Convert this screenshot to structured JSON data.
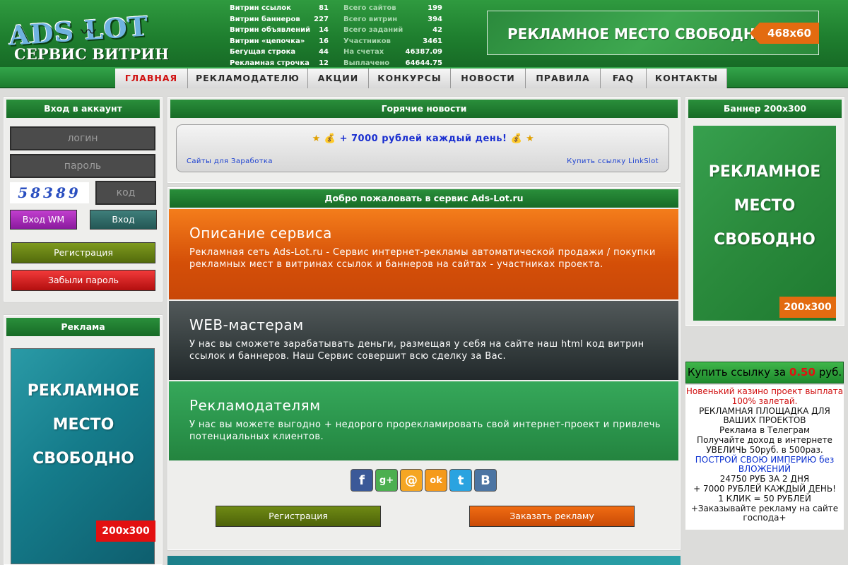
{
  "header": {
    "logo_word": "ADS  LOT",
    "logo_subtitle": "СЕРВИС ВИТРИН",
    "stats_left": [
      {
        "label": "Витрин ссылок",
        "value": "81"
      },
      {
        "label": "Витрин баннеров",
        "value": "227"
      },
      {
        "label": "Витрин объявлений",
        "value": "14"
      },
      {
        "label": "Витрин «цепочка»",
        "value": "16"
      },
      {
        "label": "Бегущая строка",
        "value": "44"
      },
      {
        "label": "Рекламная строчка",
        "value": "12"
      }
    ],
    "stats_right": [
      {
        "label": "Всего сайтов",
        "value": "199"
      },
      {
        "label": "Всего витрин",
        "value": "394"
      },
      {
        "label": "Всего заданий",
        "value": "42"
      },
      {
        "label": "Участников",
        "value": "3461"
      },
      {
        "label": "На счетах",
        "value": "46387.09"
      },
      {
        "label": "Выплачено",
        "value": "64644.75"
      }
    ],
    "banner_text": "РЕКЛАМНОЕ МЕСТО СВОБОДНО",
    "banner_size": "468x60"
  },
  "nav": [
    {
      "label": "ГЛАВНАЯ"
    },
    {
      "label": "РЕКЛАМОДАТЕЛЮ"
    },
    {
      "label": "АКЦИИ"
    },
    {
      "label": "КОНКУРСЫ"
    },
    {
      "label": "НОВОСТИ"
    },
    {
      "label": "ПРАВИЛА"
    },
    {
      "label": "FAQ"
    },
    {
      "label": "КОНТАКТЫ"
    }
  ],
  "login": {
    "title": "Вход в аккаунт",
    "login_placeholder": "логин",
    "password_placeholder": "пароль",
    "captcha_text": "58389",
    "code_placeholder": "код",
    "wm_button": "Вход WM",
    "login_button": "Вход",
    "register_button": "Регистрация",
    "forgot_button": "Забыли пароль"
  },
  "ads_left": {
    "title": "Реклама",
    "text_lines": [
      "РЕКЛАМНОЕ",
      "МЕСТО",
      "СВОБОДНО"
    ],
    "size": "200x300"
  },
  "hot_news": {
    "title": "Горячие новости",
    "headline": "+ 7000 рублей каждый день!",
    "link_left": "Сайты для Заработка",
    "link_right": "Купить ссылку LinkSlot"
  },
  "welcome": {
    "title": "Добро пожаловать в сервис Ads-Lot.ru",
    "sections": [
      {
        "heading": "Описание сервиса",
        "text": "Рекламная сеть Ads-Lot.ru - Сервис интернет-рекламы автоматической продажи / покупки рекламных мест в витринах ссылок и баннеров на сайтах - участниках проекта."
      },
      {
        "heading": "WEB-мастерам",
        "text": "У нас вы сможете зарабатывать деньги, размещая у себя на сайте наш html код витрин ссылок и баннеров. Наш Сервис совершит всю сделку за Вас."
      },
      {
        "heading": "Рекламодателям",
        "text": "У нас вы можете выгодно + недорого прорекламировать свой интернет-проект и привлечь потенциальных клиентов."
      }
    ],
    "register_button": "Регистрация",
    "order_button": "Заказать рекламу"
  },
  "social": [
    {
      "icon": "facebook-icon",
      "glyph": "f",
      "color": "#3b5998"
    },
    {
      "icon": "google-icon",
      "glyph": "g+",
      "color": "#4caf50"
    },
    {
      "icon": "mail-icon",
      "glyph": "@",
      "color": "#f5a623"
    },
    {
      "icon": "odnoklassniki-icon",
      "glyph": "ok",
      "color": "#f59a1b"
    },
    {
      "icon": "twitter-icon",
      "glyph": "t",
      "color": "#2aa3e0"
    },
    {
      "icon": "vk-icon",
      "glyph": "B",
      "color": "#4c75a3"
    }
  ],
  "banner_right": {
    "title": "Баннер 200x300",
    "text_lines": [
      "РЕКЛАМНОЕ",
      "МЕСТО",
      "СВОБОДНО"
    ],
    "size": "200x300"
  },
  "buy_link": {
    "prefix": "Купить ссылку за",
    "price": "0.50",
    "suffix": "руб."
  },
  "info_lines": [
    {
      "text": "Новенький казино проект выплата",
      "color": "red"
    },
    {
      "text": "100% залетай.",
      "color": "red"
    },
    {
      "text": "РЕКЛАМНАЯ ПЛОЩАДКА ДЛЯ",
      "color": "black"
    },
    {
      "text": "ВАШИХ ПРОЕКТОВ",
      "color": "black"
    },
    {
      "text": "Реклама в Телеграм",
      "color": "black"
    },
    {
      "text": "Получайте доход в интернете",
      "color": "black"
    },
    {
      "text": "УВЕЛИЧЬ 50руб. в 500раз.",
      "color": "black"
    },
    {
      "text": "ПОСТРОЙ СВОЮ ИМПЕРИЮ без",
      "color": "blue"
    },
    {
      "text": "ВЛОЖЕНИЙ",
      "color": "blue"
    },
    {
      "text": "24750 РУБ ЗА 2 ДНЯ",
      "color": "black"
    },
    {
      "text": "+ 7000 РУБЛЕЙ КАЖДЫЙ ДЕНЬ!",
      "color": "black"
    },
    {
      "text": "1 КЛИК = 50 РУБЛЕЙ",
      "color": "black"
    },
    {
      "text": "+Заказывайте рекламу на сайте",
      "color": "black"
    },
    {
      "text": "господа+",
      "color": "black"
    }
  ]
}
